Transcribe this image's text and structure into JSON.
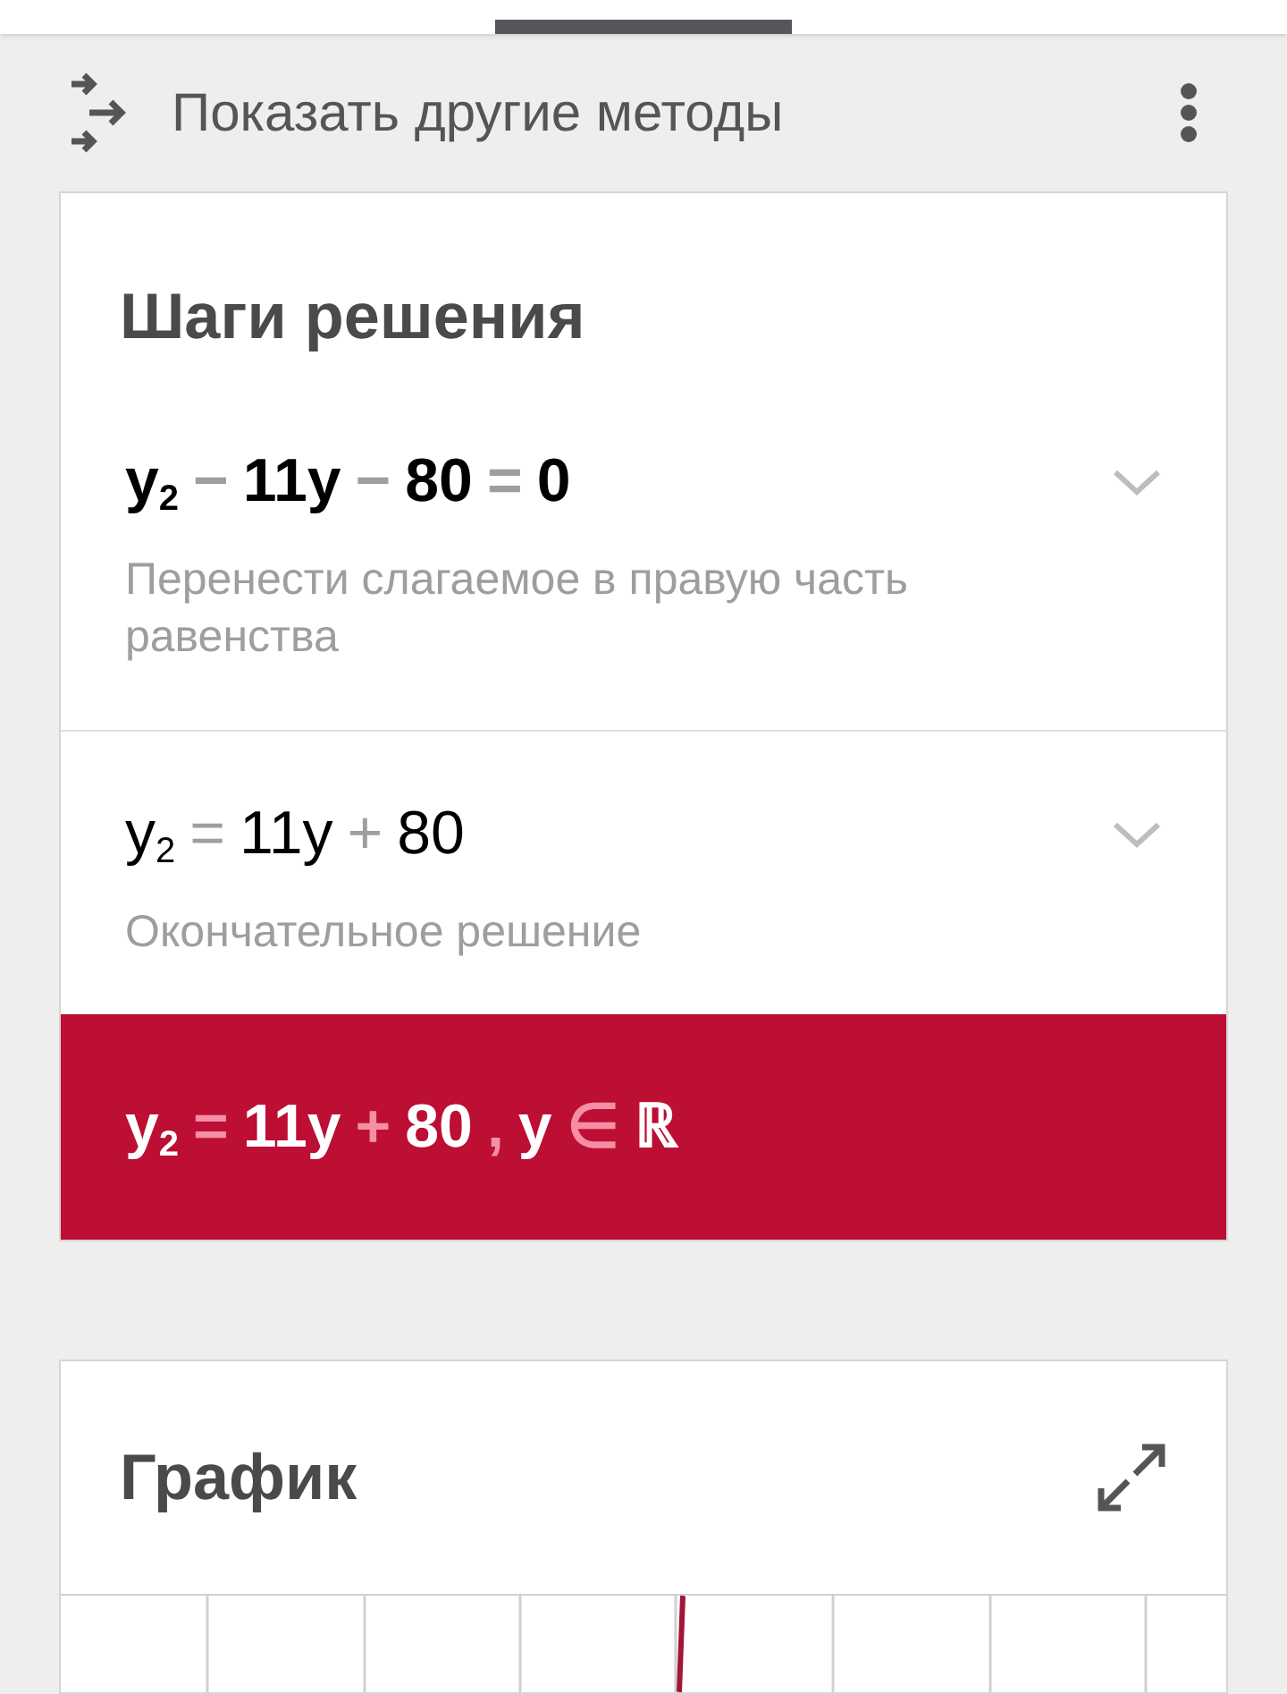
{
  "header": {
    "label": "Показать другие методы"
  },
  "solution": {
    "title": "Шаги решения",
    "steps": [
      {
        "expanded": false,
        "tokens": [
          {
            "kind": "term",
            "text": "y$_{2}$"
          },
          {
            "kind": "op",
            "text": "−"
          },
          {
            "kind": "term",
            "text": "11y"
          },
          {
            "kind": "op",
            "text": "−"
          },
          {
            "kind": "term",
            "text": "80"
          },
          {
            "kind": "op",
            "text": "="
          },
          {
            "kind": "term",
            "text": "0"
          }
        ],
        "bold": true,
        "description": "Перенести слагаемое в правую часть равенства"
      },
      {
        "expanded": false,
        "tokens": [
          {
            "kind": "term",
            "text": "y$_{2}$"
          },
          {
            "kind": "op",
            "text": "="
          },
          {
            "kind": "term",
            "text": "11y"
          },
          {
            "kind": "op",
            "text": "+"
          },
          {
            "kind": "term",
            "text": "80"
          }
        ],
        "bold": false,
        "description": "Окончательное решение"
      }
    ],
    "result": {
      "tokens": [
        {
          "kind": "term",
          "text": "y$_{2}$"
        },
        {
          "kind": "op",
          "text": "="
        },
        {
          "kind": "term",
          "text": "11y"
        },
        {
          "kind": "op",
          "text": "+"
        },
        {
          "kind": "term",
          "text": "80"
        },
        {
          "kind": "op",
          "text": ","
        },
        {
          "kind": "term",
          "text": "y"
        },
        {
          "kind": "op",
          "text": "∈"
        },
        {
          "kind": "term",
          "text": "ℝ"
        }
      ]
    }
  },
  "graph": {
    "title": "График"
  }
}
